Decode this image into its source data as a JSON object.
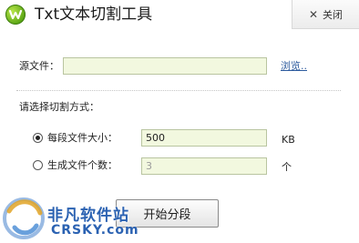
{
  "window": {
    "title": "Txt文本切割工具",
    "close_label": "关闭",
    "close_glyph": "✕"
  },
  "source": {
    "label": "源文件：",
    "value": "",
    "browse_label": "浏览.."
  },
  "split_mode": {
    "label": "请选择切割方式：",
    "options": [
      {
        "label": "每段文件大小：",
        "value": "500",
        "unit": "KB",
        "checked": true,
        "enabled": true
      },
      {
        "label": "生成文件个数：",
        "value": "3",
        "unit": "个",
        "checked": false,
        "enabled": false
      }
    ]
  },
  "actions": {
    "start_label": "开始分段"
  },
  "watermark": {
    "cn": "非凡软件站",
    "en": "CRSKY.com"
  },
  "colors": {
    "input_bg": "#f2f8df",
    "link": "#2d5b9e",
    "logo_green": "#5aa514",
    "watermark_blue": "#2b62b2"
  },
  "icons": {
    "app": "green-w-logo",
    "close": "close-x-icon"
  }
}
